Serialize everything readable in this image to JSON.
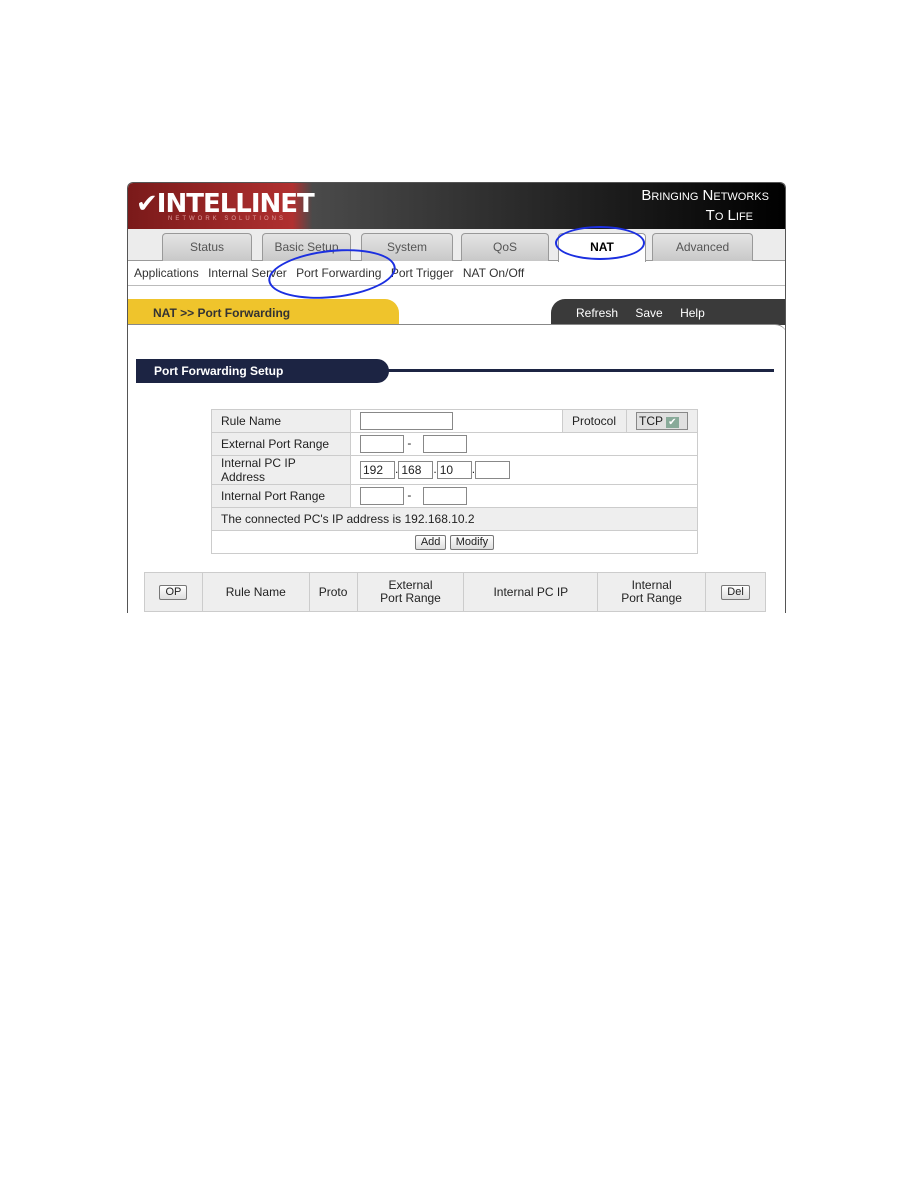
{
  "brand": {
    "logo": "INTELLINET",
    "logo_sub": "NETWORK SOLUTIONS",
    "slogan_line1": "Bringing Networks",
    "slogan_line2": "To Life"
  },
  "tabs": [
    "Status",
    "Basic Setup",
    "System",
    "QoS",
    "NAT",
    "Advanced"
  ],
  "active_tab": "NAT",
  "submenu": [
    "Applications",
    "Internal Server",
    "Port Forwarding",
    "Port Trigger",
    "NAT On/Off"
  ],
  "breadcrumb": "NAT >> Port Forwarding",
  "actions": [
    "Refresh",
    "Save",
    "Help"
  ],
  "section_title": "Port Forwarding Setup",
  "form": {
    "rule_name_label": "Rule Name",
    "rule_name_value": "",
    "protocol_label": "Protocol",
    "protocol_value": "TCP",
    "external_port_label": "External Port Range",
    "range_sep": "-",
    "internal_ip_label": "Internal PC IP Address",
    "ip": [
      "192",
      "168",
      "10",
      ""
    ],
    "internal_port_label": "Internal Port Range",
    "connected_msg": "The connected PC's IP address is 192.168.10.2",
    "add_label": "Add",
    "modify_label": "Modify"
  },
  "list": {
    "op_label": "OP",
    "columns": [
      "Rule Name",
      "Proto",
      "External Port Range",
      "Internal PC IP",
      "Internal Port Range"
    ],
    "del_label": "Del"
  },
  "colors": {
    "annotation": "#1b2fe0",
    "header_navy": "#1c2443",
    "breadcrumb_yellow": "#efc42c"
  }
}
